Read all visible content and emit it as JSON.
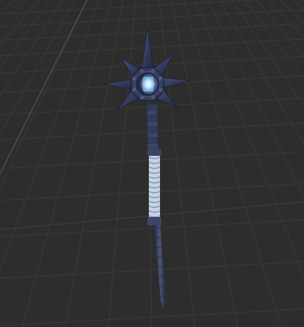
{
  "viewport": {
    "background_color": "#2d2d2d",
    "grid_color": "#3b3b3b",
    "grid_axis_green_color": "#4a5e3f",
    "grid_axis_blue_color": "#4a4f66"
  },
  "model": {
    "shaft_color": "#3d4566",
    "shaft_dark_color": "#283050",
    "grip_color": "#c5d3e4",
    "spike_color": "#2e3550",
    "head_color": "#343c5c",
    "gem_color": "#d8f0ff",
    "gem_glow_color": "#8fc7ff"
  }
}
